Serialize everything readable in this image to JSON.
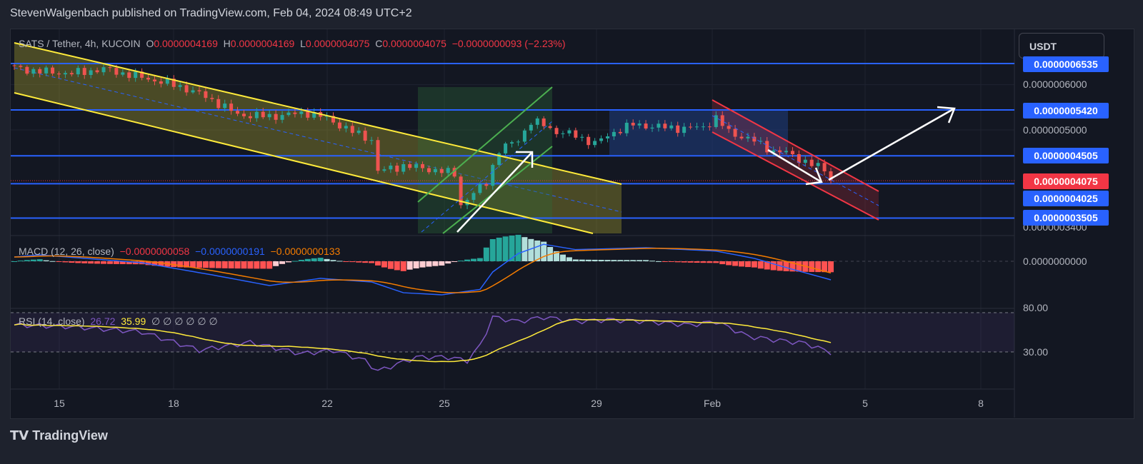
{
  "header": {
    "published": "StevenWalgenbach published on TradingView.com, Feb 04, 2024 08:49 UTC+2"
  },
  "legend": {
    "symbol": "SATS / Tether, 4h, KUCOIN",
    "o_label": "O",
    "o": "0.0000004169",
    "h_label": "H",
    "h": "0.0000004169",
    "l_label": "L",
    "l": "0.0000004075",
    "c_label": "C",
    "c": "0.0000004075",
    "change": "−0.0000000093 (−2.23%)"
  },
  "currency_button": "USDT",
  "price_axis": {
    "ticks": [
      "0.0000006000",
      "0.0000005000",
      "0.0000003400"
    ],
    "levels": [
      {
        "label": "0.0000006535",
        "value": 6535
      },
      {
        "label": "0.0000005420",
        "value": 5420
      },
      {
        "label": "0.0000004505",
        "value": 4505
      },
      {
        "label": "0.0000004025",
        "value": 4025
      },
      {
        "label": "0.0000003505",
        "value": 3505
      }
    ],
    "last_price": {
      "label": "0.0000004075",
      "value": 4075
    }
  },
  "macd": {
    "title": "MACD (12, 26, close)",
    "hist": "−0.0000000058",
    "macd": "−0.0000000191",
    "signal": "−0.0000000133",
    "zero_label": "0.0000000000"
  },
  "rsi": {
    "title": "RSI (14, close)",
    "value": "26.72",
    "ma": "35.99",
    "extras": "∅ ∅ ∅ ∅ ∅ ∅",
    "upper_label": "80.00",
    "lower_label": "30.00"
  },
  "time_axis": [
    "15",
    "18",
    "22",
    "25",
    "29",
    "Feb",
    "5",
    "8"
  ],
  "footer": {
    "brand": "TradingView"
  },
  "colors": {
    "up": "#26a69a",
    "down": "#ef5350",
    "level": "#2962ff",
    "last": "#f23645"
  },
  "chart_data": {
    "type": "candlestick",
    "title": "SATS / Tether, 4h, KUCOIN",
    "price_unit": "1e-10 USDT",
    "scale": "log",
    "candle_count": 129,
    "close_anchors": [
      [
        0,
        6423
      ],
      [
        4,
        6330
      ],
      [
        9,
        6280
      ],
      [
        14,
        6390
      ],
      [
        20,
        6180
      ],
      [
        26,
        5960
      ],
      [
        30,
        5720
      ],
      [
        35,
        5320
      ],
      [
        40,
        5280
      ],
      [
        46,
        5360
      ],
      [
        49,
        5240
      ],
      [
        53,
        4960
      ],
      [
        56,
        4810
      ],
      [
        57,
        4230
      ],
      [
        61,
        4330
      ],
      [
        65,
        4270
      ],
      [
        69,
        4190
      ],
      [
        70,
        3700
      ],
      [
        72,
        3870
      ],
      [
        74,
        4050
      ],
      [
        76,
        4600
      ],
      [
        79,
        4810
      ],
      [
        81,
        5160
      ],
      [
        83,
        5110
      ],
      [
        85,
        4960
      ],
      [
        88,
        4890
      ],
      [
        91,
        4730
      ],
      [
        94,
        4960
      ],
      [
        97,
        5110
      ],
      [
        101,
        5060
      ],
      [
        105,
        5030
      ],
      [
        108,
        5060
      ],
      [
        110,
        5240
      ],
      [
        112,
        4960
      ],
      [
        116,
        4780
      ],
      [
        119,
        4590
      ],
      [
        121,
        4560
      ],
      [
        125,
        4350
      ],
      [
        127,
        4260
      ],
      [
        128,
        4075
      ]
    ],
    "macd_anchors": [
      [
        0,
        44
      ],
      [
        4,
        66
      ],
      [
        20,
        -15
      ],
      [
        31,
        -140
      ],
      [
        40,
        -250
      ],
      [
        48,
        -176
      ],
      [
        56,
        -213
      ],
      [
        61,
        -324
      ],
      [
        67,
        -346
      ],
      [
        73,
        -290
      ],
      [
        75,
        -110
      ],
      [
        79,
        80
      ],
      [
        83,
        175
      ],
      [
        88,
        120
      ],
      [
        99,
        140
      ],
      [
        110,
        105
      ],
      [
        116,
        30
      ],
      [
        121,
        -65
      ],
      [
        128,
        -191
      ]
    ],
    "rsi_anchors": [
      [
        0,
        61
      ],
      [
        9,
        59
      ],
      [
        20,
        53
      ],
      [
        29,
        32
      ],
      [
        37,
        41
      ],
      [
        45,
        28
      ],
      [
        50,
        32
      ],
      [
        55,
        20
      ],
      [
        57,
        8
      ],
      [
        60,
        16
      ],
      [
        63,
        24
      ],
      [
        68,
        24
      ],
      [
        71,
        20
      ],
      [
        73,
        37
      ],
      [
        75,
        70
      ],
      [
        79,
        65
      ],
      [
        83,
        70
      ],
      [
        88,
        65
      ],
      [
        93,
        67
      ],
      [
        99,
        65
      ],
      [
        106,
        61
      ],
      [
        110,
        65
      ],
      [
        115,
        48
      ],
      [
        119,
        44
      ],
      [
        124,
        40
      ],
      [
        127,
        32
      ],
      [
        128,
        26.72
      ]
    ],
    "rsi_levels": [
      80,
      30
    ]
  }
}
